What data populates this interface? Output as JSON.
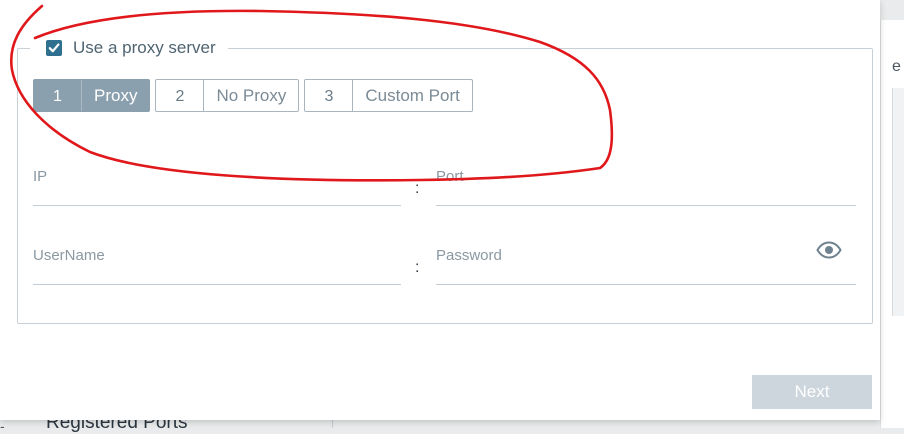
{
  "background": {
    "right_edge_text": "e",
    "bottom_text": "Registered Ports"
  },
  "proxy": {
    "checkbox_checked": true,
    "legend_label": "Use a proxy server",
    "tabs": [
      {
        "num": "1",
        "label": "Proxy",
        "active": true
      },
      {
        "num": "2",
        "label": "No Proxy",
        "active": false
      },
      {
        "num": "3",
        "label": "Custom Port",
        "active": false
      }
    ],
    "fields": {
      "ip": {
        "label": "IP",
        "value": ""
      },
      "port": {
        "label": "Port",
        "value": ""
      },
      "username": {
        "label": "UserName",
        "value": ""
      },
      "password": {
        "label": "Password",
        "value": ""
      },
      "separator": ":"
    }
  },
  "footer": {
    "next_label": "Next"
  },
  "colors": {
    "accent": "#2f6f8f",
    "tab_active": "#8ba0ae",
    "button_disabled": "#ccd6dc",
    "annotation": "#e0181b"
  },
  "icons": {
    "checkbox": "checkmark-icon",
    "password_toggle": "eye-icon"
  }
}
